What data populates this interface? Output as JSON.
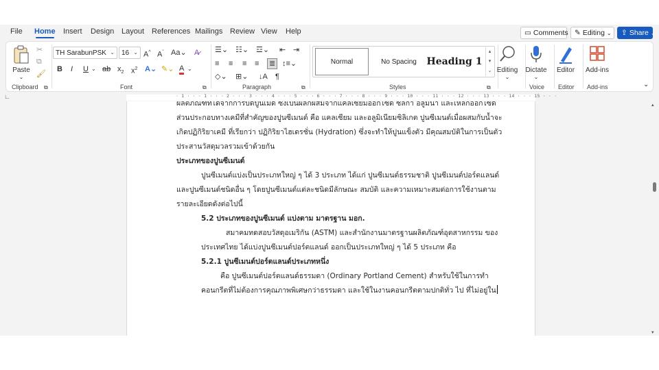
{
  "menu": {
    "tabs": [
      "File",
      "Home",
      "Insert",
      "Design",
      "Layout",
      "References",
      "Mailings",
      "Review",
      "View",
      "Help"
    ],
    "active_tab": "Home",
    "comments_label": "Comments",
    "editing_label": "Editing",
    "share_label": "Share"
  },
  "ribbon": {
    "clipboard": {
      "paste_label": "Paste",
      "group_label": "Clipboard"
    },
    "font": {
      "family": "TH SarabunPSK",
      "size": "16",
      "group_label": "Font"
    },
    "paragraph": {
      "group_label": "Paragraph"
    },
    "styles": {
      "group_label": "Styles",
      "items": [
        "Normal",
        "No Spacing",
        "Heading 1"
      ],
      "selected": "Normal"
    },
    "editing": {
      "label": "Editing"
    },
    "voice": {
      "dictate_label": "Dictate",
      "group_label": "Voice"
    },
    "editor": {
      "label": "Editor",
      "group_label": "Editor"
    },
    "addins": {
      "label": "Add-ins",
      "group_label": "Add-ins"
    }
  },
  "ruler": {
    "text": "· 1 · · · 1 · · · 2 · · · 3 · · · 4 · · · 5 · · · 6 · · · 7 · · · 8 · · · 9 · · · 10 · · · 11 · · · 12 · · · 13 · · · 14 · · · 15 · · ·"
  },
  "document": {
    "lines": [
      "ผลิตภัณฑ์ที่ได้จากการบดปูนเม็ด ซึ่งเป็นผลึกผสมจากแคลเซียมออกไซด์ ซิลิกา อลูมินา และเหล็กออกไซด์",
      "ส่วนประกอบทางเคมีที่สำคัญของปูนซีเมนต์ คือ แคลเซียม และอลูมิเนียมซิลิเกต ปูนซีเมนต์เมื่อผสมกับน้ำจะ",
      "เกิดปฏิกิริยาเคมี ที่เรียกว่า ปฏิกิริยาไฮเดรชั่น (Hydration) ซึ่งจะทำให้ปูนแข็งตัว มีคุณสมบัติในการเป็นตัว",
      "ประสานวัสดุมวลรวมเข้าด้วยกัน",
      "ประเภทของปูนซีเมนต์",
      "ปูนซีเมนต์แบ่งเป็นประเภทใหญ่ ๆ ได้ 3 ประเภท ได้แก่ ปูนซีเมนต์ธรรมชาติ ปูนซีเมนต์ปอร์ตแลนด์",
      "และปูนซีเมนต์ชนิดอื่น ๆ โดยปูนซีเมนต์แต่ละชนิดมีลักษณะ สมบัติ และความเหมาะสมต่อการใช้งานตาม",
      "รายละเอียดดังต่อไปนี้",
      "5.2 ประเภทของปูนซีเมนต์ แบ่งตาม มาตรฐาน มอก.",
      "สมาคมทดสอบวัสดุอเมริกัน (ASTM) และสำนักงานมาตรฐานผลิตภัณฑ์อุตสาหกรรม ของ",
      "ประเทศไทย ได้แบ่งปูนซีเมนต์ปอร์ตแลนด์ ออกเป็นประเภทใหญ่ ๆ ได้ 5 ประเภท คือ",
      "5.2.1 ปูนซีเมนต์ปอร์ตแลนด์ประเภทหนึ่ง",
      "คือ ปูนซีเมนต์ปอร์ตแลนด์ธรรมดา (Ordinary Portland Cement) สำหรับใช้ในการทำ",
      "คอนกรีตที่ไม่ต้องการคุณภาพพิเศษกว่าธรรมดา และใช้ในงานคอนกรีตตามปกติทั่ว ไป ที่ไม่อยู่ใน"
    ]
  }
}
